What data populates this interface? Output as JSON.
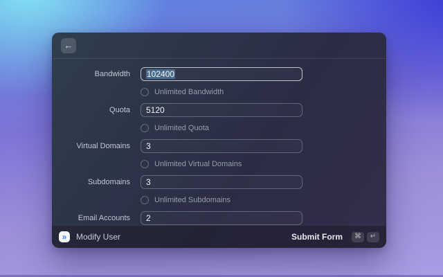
{
  "window": {
    "back_button_glyph": "←"
  },
  "form": {
    "fields": [
      {
        "label": "Bandwidth",
        "value": "102400",
        "state": "focused-selected",
        "checkbox_label": "Unlimited Bandwidth"
      },
      {
        "label": "Quota",
        "value": "5120",
        "checkbox_label": "Unlimited Quota"
      },
      {
        "label": "Virtual Domains",
        "value": "3",
        "checkbox_label": "Unlimited Virtual Domains"
      },
      {
        "label": "Subdomains",
        "value": "3",
        "checkbox_label": "Unlimited Subdomains"
      },
      {
        "label": "Email Accounts",
        "value": "2"
      }
    ]
  },
  "footer": {
    "app_icon_glyph": "»",
    "title": "Modify User",
    "submit_label": "Submit Form",
    "shortcut_keys": [
      "⌘",
      "↵"
    ]
  },
  "colors": {
    "selection_highlight": "#4a6a8c",
    "app_icon_blue": "#3b82f6",
    "background_top_left": "#85e5f3",
    "background_top_right": "#3a37d7",
    "background_bottom": "#a89de2"
  }
}
